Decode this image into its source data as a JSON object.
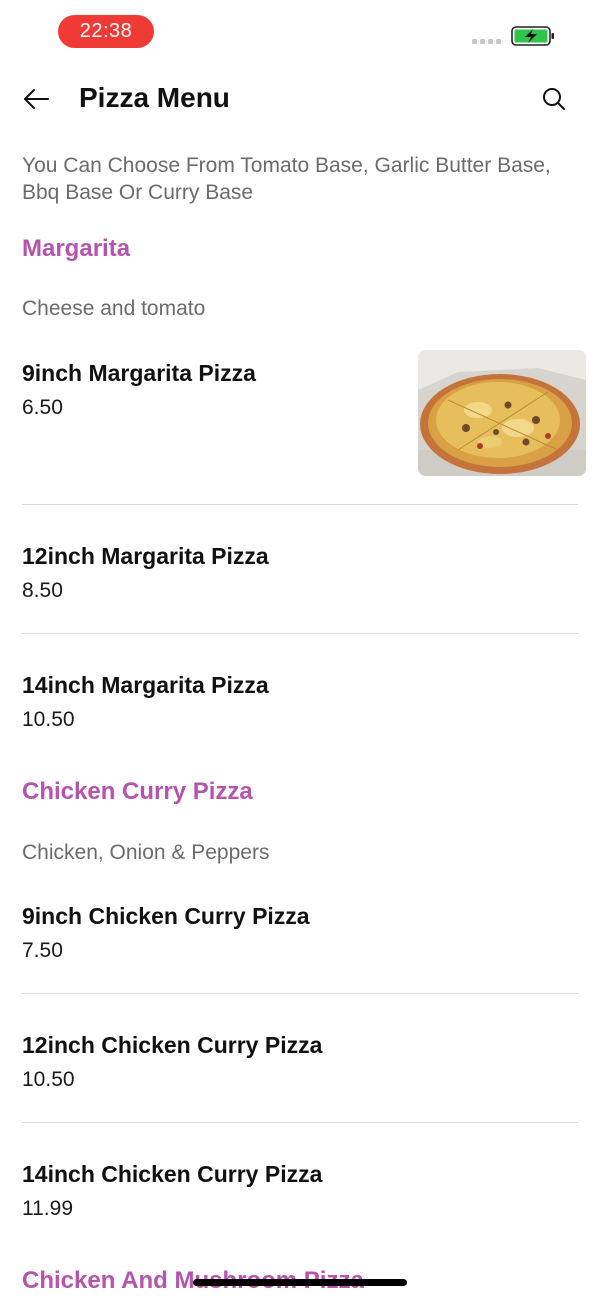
{
  "status": {
    "time": "22:38"
  },
  "header": {
    "title": "Pizza Menu"
  },
  "intro": "You Can Choose From Tomato Base, Garlic Butter Base, Bbq Base Or Curry Base",
  "categories": [
    {
      "title": "Margarita",
      "description": "Cheese and tomato",
      "items": [
        {
          "name": "9inch Margarita Pizza",
          "price": "6.50"
        },
        {
          "name": "12inch Margarita Pizza",
          "price": "8.50"
        },
        {
          "name": "14inch Margarita Pizza",
          "price": "10.50"
        }
      ]
    },
    {
      "title": "Chicken Curry Pizza",
      "description": "Chicken, Onion & Peppers",
      "items": [
        {
          "name": "9inch Chicken Curry Pizza",
          "price": "7.50"
        },
        {
          "name": "12inch Chicken Curry Pizza",
          "price": "10.50"
        },
        {
          "name": "14inch Chicken Curry Pizza",
          "price": "11.99"
        }
      ]
    },
    {
      "title": "Chicken And Mushroom Pizza"
    }
  ],
  "colors": {
    "accent": "#b454ad",
    "time_pill": "#f03a36",
    "battery": "#2fc44a"
  }
}
